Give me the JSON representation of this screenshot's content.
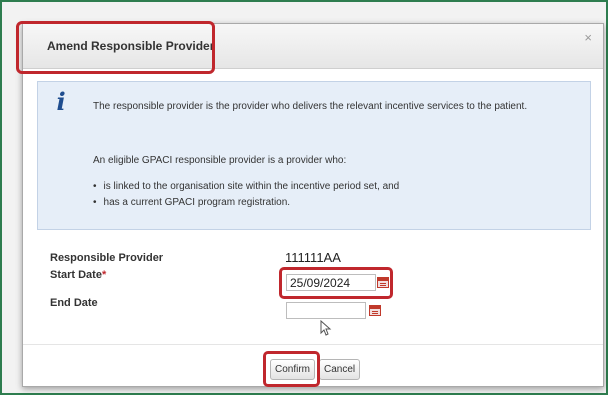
{
  "dialog": {
    "title": "Amend Responsible Provider",
    "close_glyph": "×"
  },
  "info": {
    "icon": "info-icon",
    "paragraph1": "The responsible provider is the provider who delivers the relevant incentive services to the patient.",
    "paragraph2": "An eligible GPACI responsible provider is a provider who:",
    "bullets": [
      "is linked to the organisation site within the incentive period set, and",
      "has a current GPACI program registration."
    ]
  },
  "form": {
    "responsible_provider_label": "Responsible Provider",
    "responsible_provider_value": "111111AA",
    "start_date_label": "Start Date",
    "required_marker": "*",
    "start_date_value": "25/09/2024",
    "end_date_label": "End Date",
    "end_date_value": ""
  },
  "buttons": {
    "confirm": "Confirm",
    "cancel": "Cancel"
  },
  "colors": {
    "highlight": "#c0272d",
    "frame": "#2e7d4f",
    "info_background": "#e6eef8"
  }
}
